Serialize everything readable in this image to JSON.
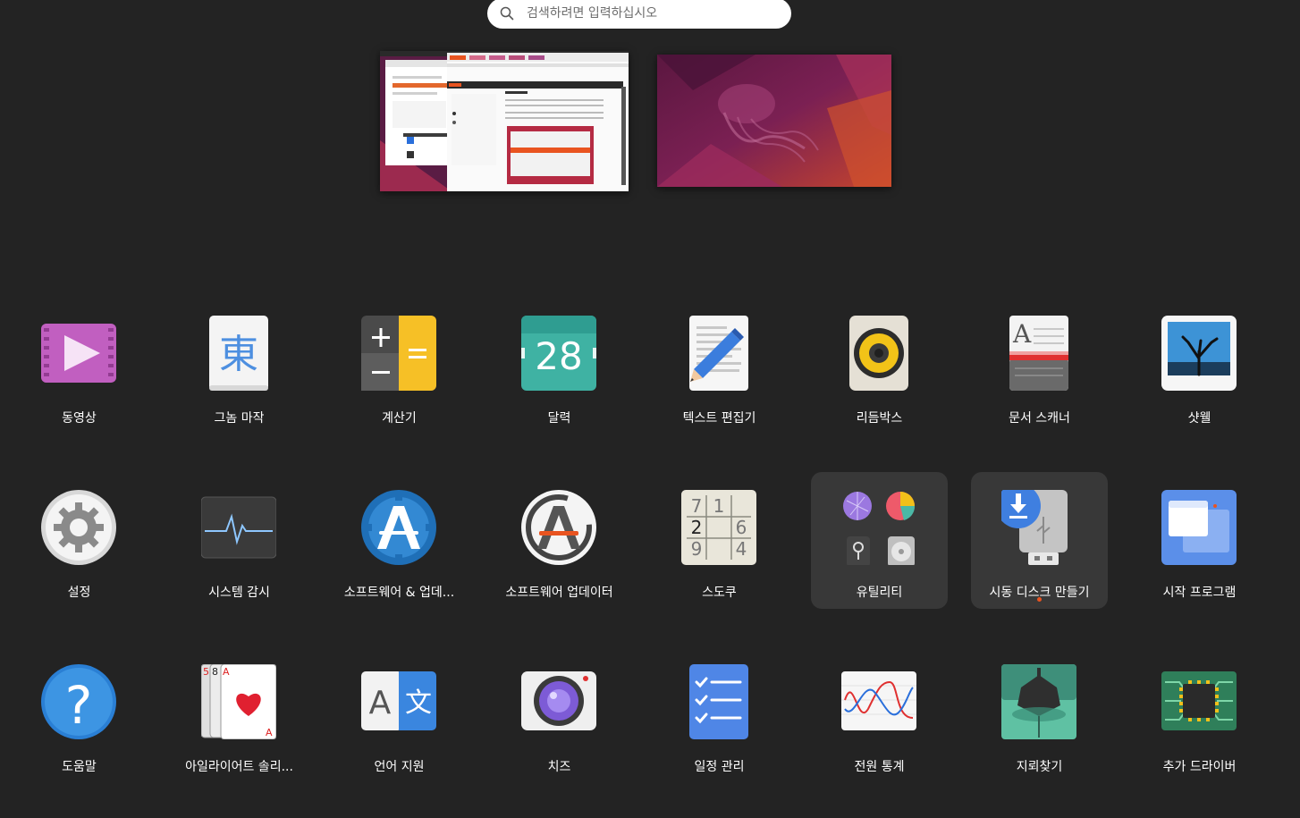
{
  "search": {
    "placeholder": "검색하려면 입력하십시오"
  },
  "colors": {
    "background": "#232323",
    "highlight": "#383838",
    "running_indicator": "#e95420"
  },
  "workspaces": [
    {
      "name": "workspace-1"
    },
    {
      "name": "workspace-2"
    }
  ],
  "apps": [
    {
      "label": "동영상",
      "icon": "videos-icon"
    },
    {
      "label": "그놈 마작",
      "icon": "mahjongg-icon"
    },
    {
      "label": "계산기",
      "icon": "calculator-icon"
    },
    {
      "label": "달력",
      "icon": "calendar-icon",
      "icon_text": "28"
    },
    {
      "label": "텍스트 편집기",
      "icon": "text-editor-icon"
    },
    {
      "label": "리듬박스",
      "icon": "rhythmbox-icon"
    },
    {
      "label": "문서 스캐너",
      "icon": "document-scanner-icon"
    },
    {
      "label": "샷웰",
      "icon": "shotwell-icon"
    },
    {
      "label": "설정",
      "icon": "settings-icon"
    },
    {
      "label": "시스템 감시",
      "icon": "system-monitor-icon"
    },
    {
      "label": "소프트웨어 & 업데...",
      "icon": "software-updates-icon"
    },
    {
      "label": "소프트웨어 업데이터",
      "icon": "software-updater-icon"
    },
    {
      "label": "스도쿠",
      "icon": "sudoku-icon",
      "icon_digits": [
        "7",
        "1",
        "2",
        "6",
        "9",
        "4"
      ]
    },
    {
      "label": "유틸리티",
      "icon": "utilities-folder-icon"
    },
    {
      "label": "시동 디스크 만들기",
      "icon": "startup-disk-creator-icon"
    },
    {
      "label": "시작 프로그램",
      "icon": "startup-applications-icon"
    },
    {
      "label": "도움말",
      "icon": "help-icon",
      "icon_text": "?"
    },
    {
      "label": "아일라이어트 솔리...",
      "icon": "aisleriot-solitaire-icon"
    },
    {
      "label": "언어 지원",
      "icon": "language-support-icon",
      "icon_text": "A",
      "icon_text2": "文"
    },
    {
      "label": "치즈",
      "icon": "cheese-icon"
    },
    {
      "label": "일정 관리",
      "icon": "todo-icon"
    },
    {
      "label": "전원 통계",
      "icon": "power-statistics-icon"
    },
    {
      "label": "지뢰찾기",
      "icon": "mines-icon"
    },
    {
      "label": "추가 드라이버",
      "icon": "additional-drivers-icon"
    }
  ]
}
